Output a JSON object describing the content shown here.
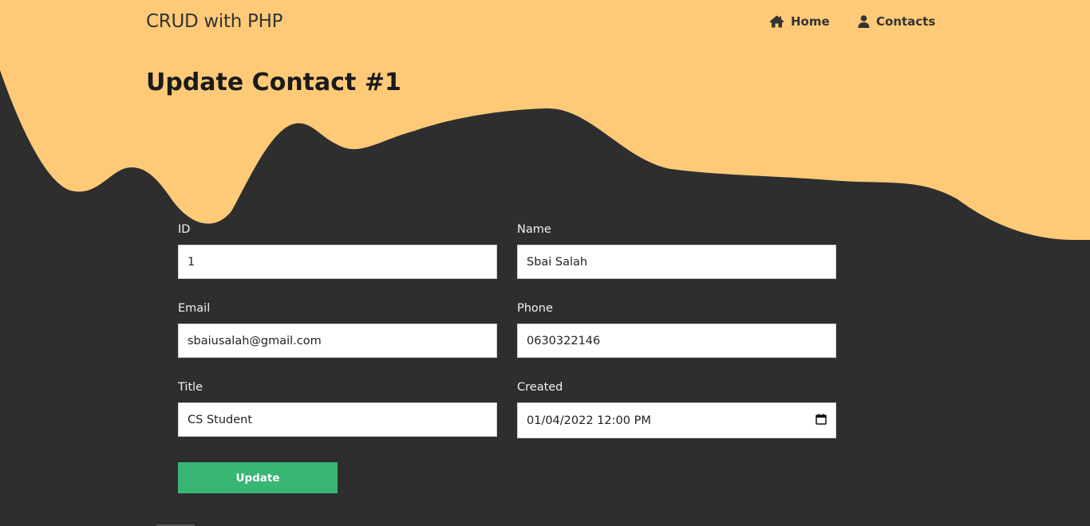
{
  "colors": {
    "background": "#2e2e2e",
    "wave": "#ffca78",
    "button": "#38b673",
    "nav_text": "#333333"
  },
  "nav": {
    "brand": "CRUD with PHP",
    "home": {
      "label": "Home",
      "icon": "home-icon"
    },
    "contacts": {
      "label": "Contacts",
      "icon": "user-icon"
    }
  },
  "page": {
    "title": "Update Contact #1"
  },
  "form": {
    "id": {
      "label": "ID",
      "value": "1"
    },
    "name": {
      "label": "Name",
      "value": "Sbai Salah"
    },
    "email": {
      "label": "Email",
      "value": "sbaiusalah@gmail.com"
    },
    "phone": {
      "label": "Phone",
      "value": "0630322146"
    },
    "title": {
      "label": "Title",
      "value": "CS Student"
    },
    "created": {
      "label": "Created",
      "value": "01/04/2022 12:00 PM",
      "icon": "calendar-icon"
    },
    "submit_label": "Update"
  }
}
